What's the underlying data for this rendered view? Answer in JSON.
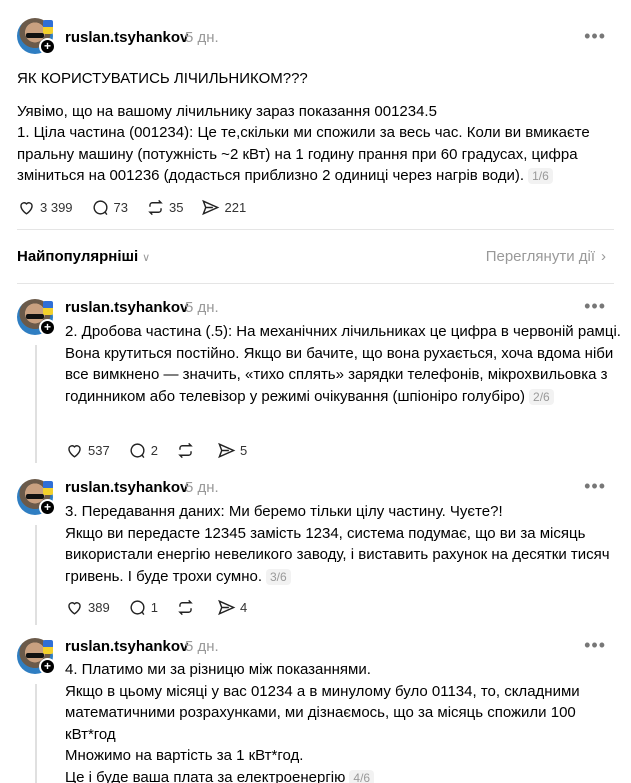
{
  "main_post": {
    "author": "ruslan.tsyhankov",
    "time": "5 дн.",
    "title": "ЯК КОРИСТУВАТИСЬ ЛІЧИЛЬНИКОМ???",
    "lines": [
      "Уявімо, що на вашому лічильнику зараз показання 001234.5",
      "1. Ціла частина (001234): Це те,скільки ми спожили за весь час. Коли ви вмикаєте пральну машину (потужність ~2 кВт) на 1 годину прання при 60 градусах, цифра зміниться на 001236 (додасться приблизно 2 одиниці через нагрів води)."
    ],
    "pager": "1/6",
    "likes": "3 399",
    "replies": "73",
    "reposts": "35",
    "shares": "221"
  },
  "sort": {
    "label": "Найпопулярніші",
    "view_activity": "Переглянути дії"
  },
  "replies": [
    {
      "author": "ruslan.tsyhankov",
      "time": "5 дн.",
      "lines": [
        "2. Дробова частина (.5): На механічних лічильниках це цифра в червоній рамці. Вона крутиться постійно. Якщо ви бачите, що вона рухається, хоча вдома ніби все вимкнено — значить, «тихо сплять» зарядки телефонів, мікрохвильовка з годинником або телевізор у режимі очікування (шпіоніро голубіро)"
      ],
      "pager": "2/6",
      "likes": "537",
      "replies": "2",
      "reposts": "",
      "shares": "5"
    },
    {
      "author": "ruslan.tsyhankov",
      "time": "5 дн.",
      "lines": [
        "3. Передавання даних: Ми беремо тільки цілу частину. Чуєте?!",
        "Якщо ви передасте 12345 замість 1234, система подумає, що ви за місяць використали енергію невеликого заводу, і виставить рахунок на десятки тисяч гривень. І буде трохи сумно."
      ],
      "pager": "3/6",
      "likes": "389",
      "replies": "1",
      "reposts": "",
      "shares": "4"
    },
    {
      "author": "ruslan.tsyhankov",
      "time": "5 дн.",
      "lines": [
        "4. Платимо ми за різницю між показаннями.",
        "Якщо в цьому місяці у вас 01234 а в минулому було 01134, то, складними математичними розрахунками, ми дізнаємось, що за місяць спожили 100 кВт*год",
        "Множимо на вартість за 1 кВт*год.",
        "Це і буде ваша плата за електроенергію"
      ],
      "pager": "4/6"
    }
  ]
}
